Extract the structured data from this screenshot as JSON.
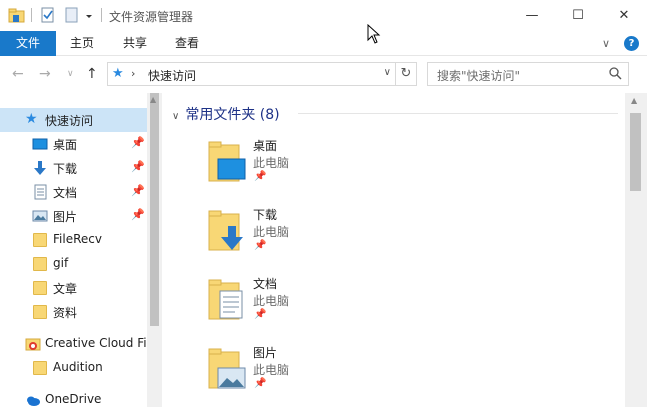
{
  "window": {
    "title": "文件资源管理器",
    "minimize_glyph": "—",
    "maximize_glyph": "☐",
    "close_glyph": "✕"
  },
  "ribbon": {
    "tabs": [
      {
        "label": "文件",
        "active": true
      },
      {
        "label": "主页"
      },
      {
        "label": "共享"
      },
      {
        "label": "查看"
      }
    ],
    "collapse_glyph": "∨",
    "help_glyph": "?"
  },
  "navigation": {
    "back_glyph": "←",
    "forward_glyph": "→",
    "recent_glyph": "∨",
    "up_glyph": "↑",
    "address": {
      "crumb_separator": "›",
      "location": "快速访问",
      "dropdown_glyph": "∨"
    },
    "refresh_glyph": "↻",
    "search": {
      "placeholder": "搜索\"快速访问\"",
      "icon": "search-icon"
    }
  },
  "nav_pane": {
    "items": [
      {
        "label": "快速访问",
        "icon": "star-icon",
        "selected": true
      },
      {
        "label": "桌面",
        "icon": "desktop-icon",
        "pinned": true
      },
      {
        "label": "下载",
        "icon": "download-icon",
        "pinned": true
      },
      {
        "label": "文档",
        "icon": "document-icon",
        "pinned": true
      },
      {
        "label": "图片",
        "icon": "picture-icon",
        "pinned": true
      },
      {
        "label": "FileRecv",
        "icon": "folder-icon"
      },
      {
        "label": "gif",
        "icon": "folder-icon"
      },
      {
        "label": "文章",
        "icon": "folder-icon"
      },
      {
        "label": "资料",
        "icon": "folder-icon"
      },
      {
        "label": "Creative Cloud Fil",
        "icon": "creative-cloud-icon"
      },
      {
        "label": "Audition",
        "icon": "folder-icon"
      },
      {
        "label": "OneDrive",
        "icon": "onedrive-icon"
      }
    ],
    "pin_glyph": "📌"
  },
  "content": {
    "group_title": "常用文件夹 (8)",
    "tiles": [
      {
        "name": "桌面",
        "location": "此电脑",
        "icon": "desktop-folder-icon"
      },
      {
        "name": "下载",
        "location": "此电脑",
        "icon": "download-folder-icon"
      },
      {
        "name": "文档",
        "location": "此电脑",
        "icon": "document-folder-icon"
      },
      {
        "name": "图片",
        "location": "此电脑",
        "icon": "picture-folder-icon"
      }
    ]
  },
  "colors": {
    "accent": "#1979ca",
    "selection": "#cce4f7",
    "folder": "#f8d775",
    "group_header": "#1e3287"
  }
}
